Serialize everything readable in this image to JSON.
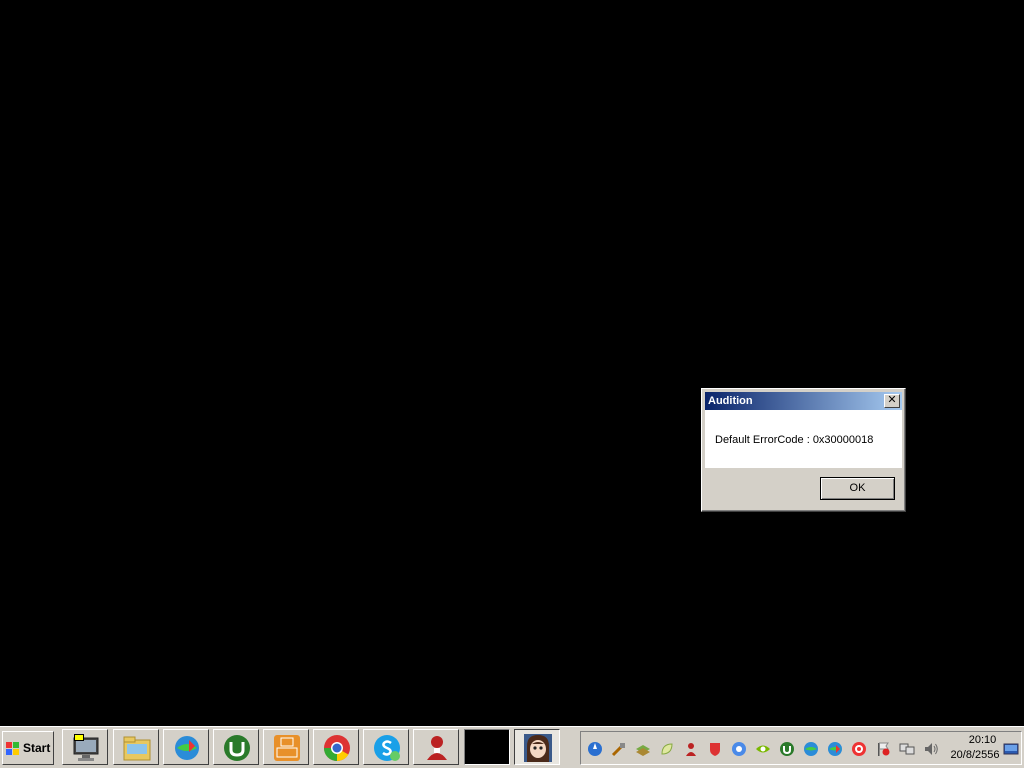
{
  "dialog": {
    "title": "Audition",
    "close_glyph": "✕",
    "message": "Default ErrorCode : 0x30000018",
    "ok_label": "OK"
  },
  "taskbar": {
    "start_label": "Start",
    "buttons": [
      {
        "icon": "monitor-icon"
      },
      {
        "icon": "folder-icon"
      },
      {
        "icon": "download-manager-icon"
      },
      {
        "icon": "utorrent-icon"
      },
      {
        "icon": "pdf-icon"
      },
      {
        "icon": "chrome-icon"
      },
      {
        "icon": "skype-icon"
      },
      {
        "icon": "game-avatar-icon"
      },
      {
        "icon": "black-window-icon"
      },
      {
        "icon": "audition-avatar-icon"
      }
    ],
    "tray_icons": [
      "speedfan-icon",
      "tools-icon",
      "layers-icon",
      "leaf-icon",
      "red-figure-icon",
      "shield-icon",
      "network-icon",
      "nvidia-icon",
      "utorrent-tray-icon",
      "globe-tray-icon",
      "globe-tray2-icon",
      "target-icon",
      "flag-icon",
      "network-connection-icon",
      "volume-icon",
      "show-desktop-icon"
    ],
    "clock": {
      "time": "20:10",
      "date": "20/8/2556"
    }
  },
  "colors": {
    "desktop": "#000000",
    "titlebar_start": "#0a246a",
    "titlebar_end": "#a6caf0",
    "face": "#d4d0c8"
  }
}
